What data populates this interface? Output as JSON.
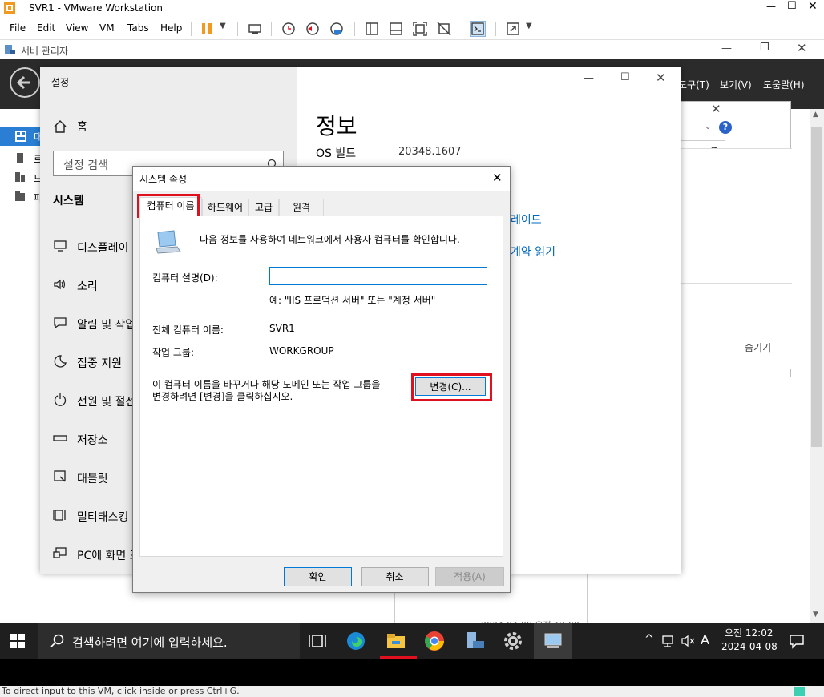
{
  "vmware": {
    "title": "SVR1 - VMware Workstation",
    "menu": [
      "File",
      "Edit",
      "View",
      "VM",
      "Tabs",
      "Help"
    ],
    "status": "To direct input to this VM, click inside or press Ctrl+G."
  },
  "server_manager": {
    "title": "서버 관리자",
    "menu": [
      "도구(T)",
      "보기(V)",
      "도움말(H)"
    ],
    "left_items": [
      "대",
      "로",
      "모",
      "파"
    ],
    "bg_dialog": {
      "hide_label": "숨기기",
      "date_text": "2024-04-08 오전 12:00"
    }
  },
  "settings": {
    "title": "설정",
    "home_label": "홈",
    "search_placeholder": "설정 검색",
    "section": "시스템",
    "nav": [
      {
        "label": "디스플레이",
        "icon": "monitor-icon"
      },
      {
        "label": "소리",
        "icon": "speaker-icon"
      },
      {
        "label": "알림 및 작업",
        "icon": "notification-icon"
      },
      {
        "label": "집중 지원",
        "icon": "moon-icon"
      },
      {
        "label": "전원 및 절전",
        "icon": "power-icon"
      },
      {
        "label": "저장소",
        "icon": "storage-icon"
      },
      {
        "label": "태블릿",
        "icon": "tablet-icon"
      },
      {
        "label": "멀티태스킹",
        "icon": "multitask-icon"
      },
      {
        "label": "PC에 화면 표시",
        "icon": "project-icon"
      }
    ],
    "content_title": "정보",
    "os_build_label": "OS 빌드",
    "os_build_value": "20348.1607",
    "link_upgrade": "레이드",
    "link_terms": "계약 읽기"
  },
  "dialog": {
    "title": "시스템 속성",
    "tabs": [
      "컴퓨터 이름",
      "하드웨어",
      "고급",
      "원격"
    ],
    "intro": "다음 정보를 사용하여 네트워크에서 사용자 컴퓨터를 확인합니다.",
    "desc_label": "컴퓨터 설명(D):",
    "desc_value": "",
    "example": "예: \"IIS 프로덕션 서버\" 또는 \"계정 서버\"",
    "full_name_label": "전체 컴퓨터 이름:",
    "full_name_value": "SVR1",
    "workgroup_label": "작업 그룹:",
    "workgroup_value": "WORKGROUP",
    "change_text_1": "이 컴퓨터 이름을 바꾸거나 해당 도메인 또는 작업 그룹을",
    "change_text_2": "변경하려면 [변경]을 클릭하십시오.",
    "change_button": "변경(C)...",
    "ok": "확인",
    "cancel": "취소",
    "apply": "적용(A)"
  },
  "taskbar": {
    "search_placeholder": "검색하려면 여기에 입력하세요.",
    "time": "오전 12:02",
    "date": "2024-04-08",
    "ime": "A"
  },
  "colors": {
    "highlight_red": "#e0101e",
    "link_blue": "#0067c0",
    "taskbar": "#1f1f1f"
  }
}
